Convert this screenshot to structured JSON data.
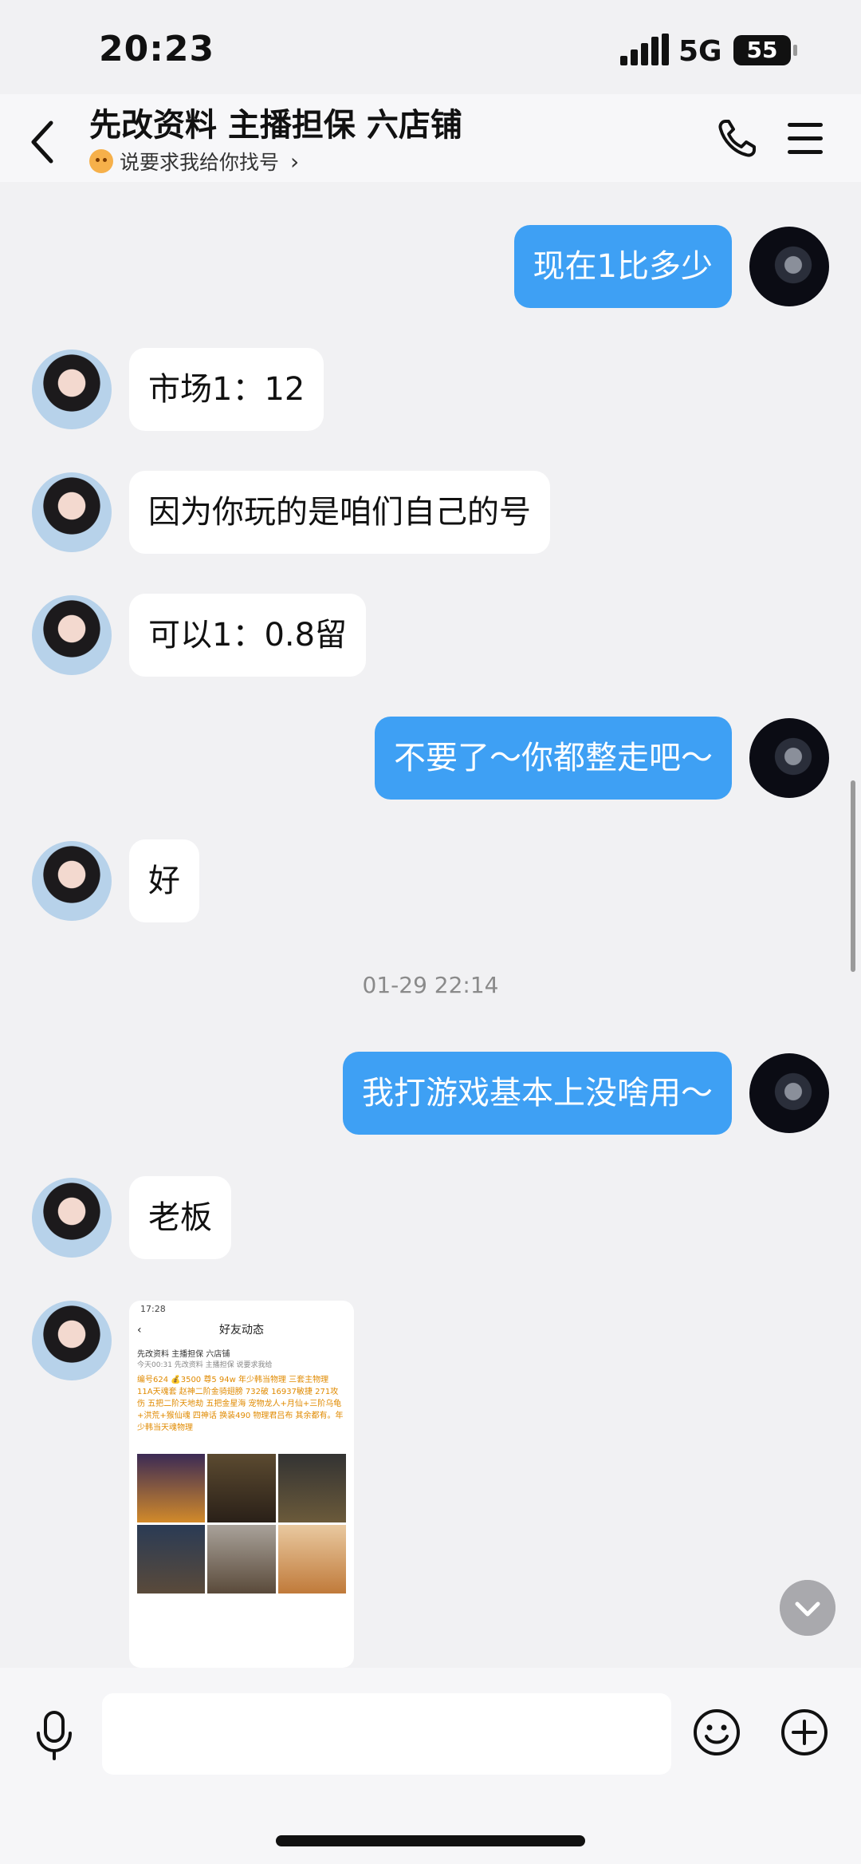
{
  "status_bar": {
    "time": "20:23",
    "network": "5G",
    "battery": "55"
  },
  "header": {
    "title": "先改资料 主播担保 六店铺",
    "subtitle": "说要求我给你找号",
    "subtitle_chevron": "›"
  },
  "messages": [
    {
      "from": "me",
      "text": "现在1比多少"
    },
    {
      "from": "them",
      "text": "市场1：12"
    },
    {
      "from": "them",
      "text": "因为你玩的是咱们自己的号"
    },
    {
      "from": "them",
      "text": "可以1：0.8留"
    },
    {
      "from": "me",
      "text": "不要了～你都整走吧～"
    },
    {
      "from": "them",
      "text": "好"
    },
    {
      "timestamp": "01-29 22:14"
    },
    {
      "from": "me",
      "text": "我打游戏基本上没啥用～"
    },
    {
      "from": "them",
      "text": "老板"
    }
  ],
  "image_message": {
    "time": "17:28",
    "nav_title": "好友动态",
    "back_glyph": "‹",
    "poster": "先改资料 主播担保 六店铺",
    "poster_meta": "今天00:31 先改资料 主播担保 说要求我给",
    "post_text": "编号624 💰3500 尊5 94w 年少韩当物理 三套主物理 11A天魂套 赵神二阶金骑翅膀 732破 16937敏捷 271攻伤 五把二阶天地劫 五把金星海 宠物龙人+月仙+三阶乌龟+洪荒+猴仙魂 四神话 换装490 物理君吕布 其余都有。年少韩当天魂物理"
  },
  "input": {
    "placeholder": ""
  },
  "icons": {
    "back": "back-arrow-icon",
    "phone": "phone-icon",
    "menu": "menu-icon",
    "mic": "microphone-icon",
    "emoji": "smiley-icon",
    "plus": "plus-icon",
    "scroll_down": "chevron-down-icon"
  },
  "colors": {
    "outgoing_bubble": "#3ea0f4",
    "incoming_bubble": "#ffffff",
    "background": "#f1f1f3"
  }
}
